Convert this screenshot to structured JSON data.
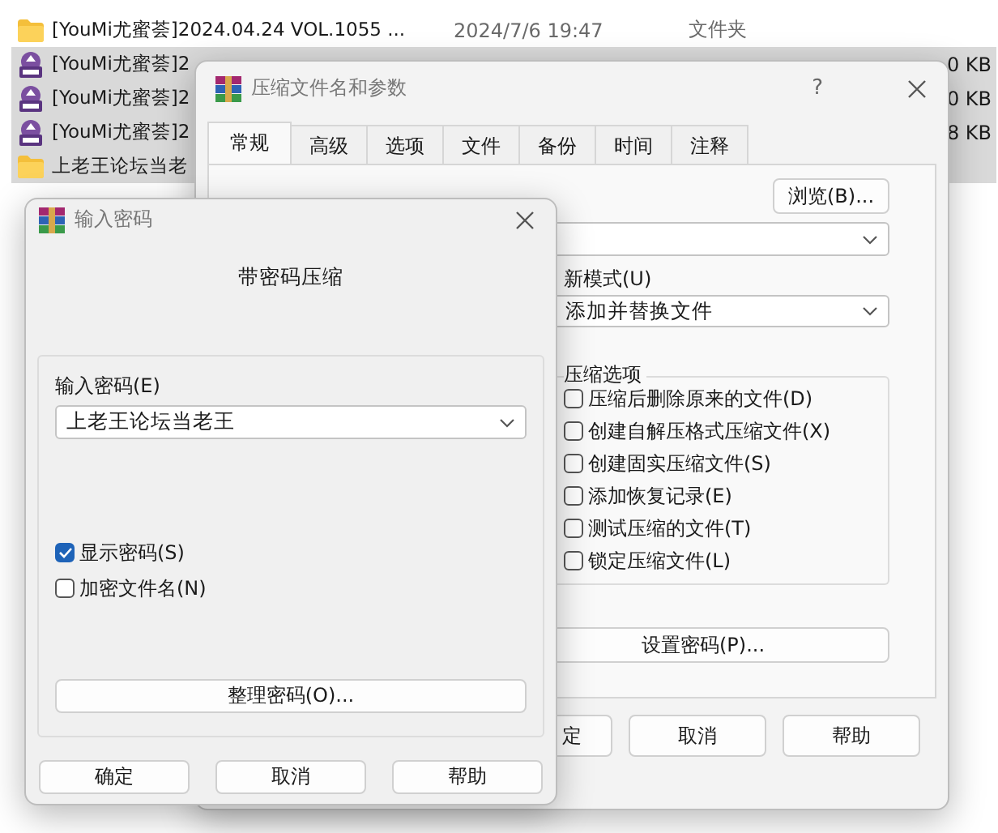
{
  "explorer": {
    "rows": [
      {
        "kind": "folder",
        "name": "[YouMi尤蜜荟]2024.04.24 VOL.1055 ...",
        "date": "2024/7/6 19:47",
        "type": "文件夹",
        "selected": false
      },
      {
        "kind": "rar",
        "name": "[YouMi尤蜜荟]2",
        "size": "0 KB",
        "selected": true
      },
      {
        "kind": "rar",
        "name": "[YouMi尤蜜荟]2",
        "size": "0 KB",
        "selected": true
      },
      {
        "kind": "rar",
        "name": "[YouMi尤蜜荟]2",
        "size": "8 KB",
        "selected": true
      },
      {
        "kind": "folder",
        "name": "上老王论坛当老",
        "selected": true
      }
    ]
  },
  "archive_dialog": {
    "title": "压缩文件名和参数",
    "help": "?",
    "tabs": [
      {
        "label": "常规",
        "selected": true
      },
      {
        "label": "高级",
        "selected": false
      },
      {
        "label": "选项",
        "selected": false
      },
      {
        "label": "文件",
        "selected": false
      },
      {
        "label": "备份",
        "selected": false
      },
      {
        "label": "时间",
        "selected": false
      },
      {
        "label": "注释",
        "selected": false
      }
    ],
    "browse_button": "浏览(B)...",
    "update_mode": {
      "label": "新模式(U)",
      "value": "添加并替换文件"
    },
    "options": {
      "title": "压缩选项",
      "items": [
        {
          "label": "压缩后删除原来的文件(D)",
          "checked": false
        },
        {
          "label": "创建自解压格式压缩文件(X)",
          "checked": false
        },
        {
          "label": "创建固实压缩文件(S)",
          "checked": false
        },
        {
          "label": "添加恢复记录(E)",
          "checked": false
        },
        {
          "label": "测试压缩的文件(T)",
          "checked": false
        },
        {
          "label": "锁定压缩文件(L)",
          "checked": false
        }
      ]
    },
    "set_password_button": "设置密码(P)...",
    "buttons": [
      "定",
      "取消",
      "帮助"
    ]
  },
  "password_dialog": {
    "title": "输入密码",
    "heading": "带密码压缩",
    "password": {
      "label": "输入密码(E)",
      "value": "上老王论坛当老王"
    },
    "checkboxes": [
      {
        "label": "显示密码(S)",
        "checked": true
      },
      {
        "label": "加密文件名(N)",
        "checked": false
      }
    ],
    "organize_button": "整理密码(O)...",
    "buttons": [
      "确定",
      "取消",
      "帮助"
    ]
  }
}
